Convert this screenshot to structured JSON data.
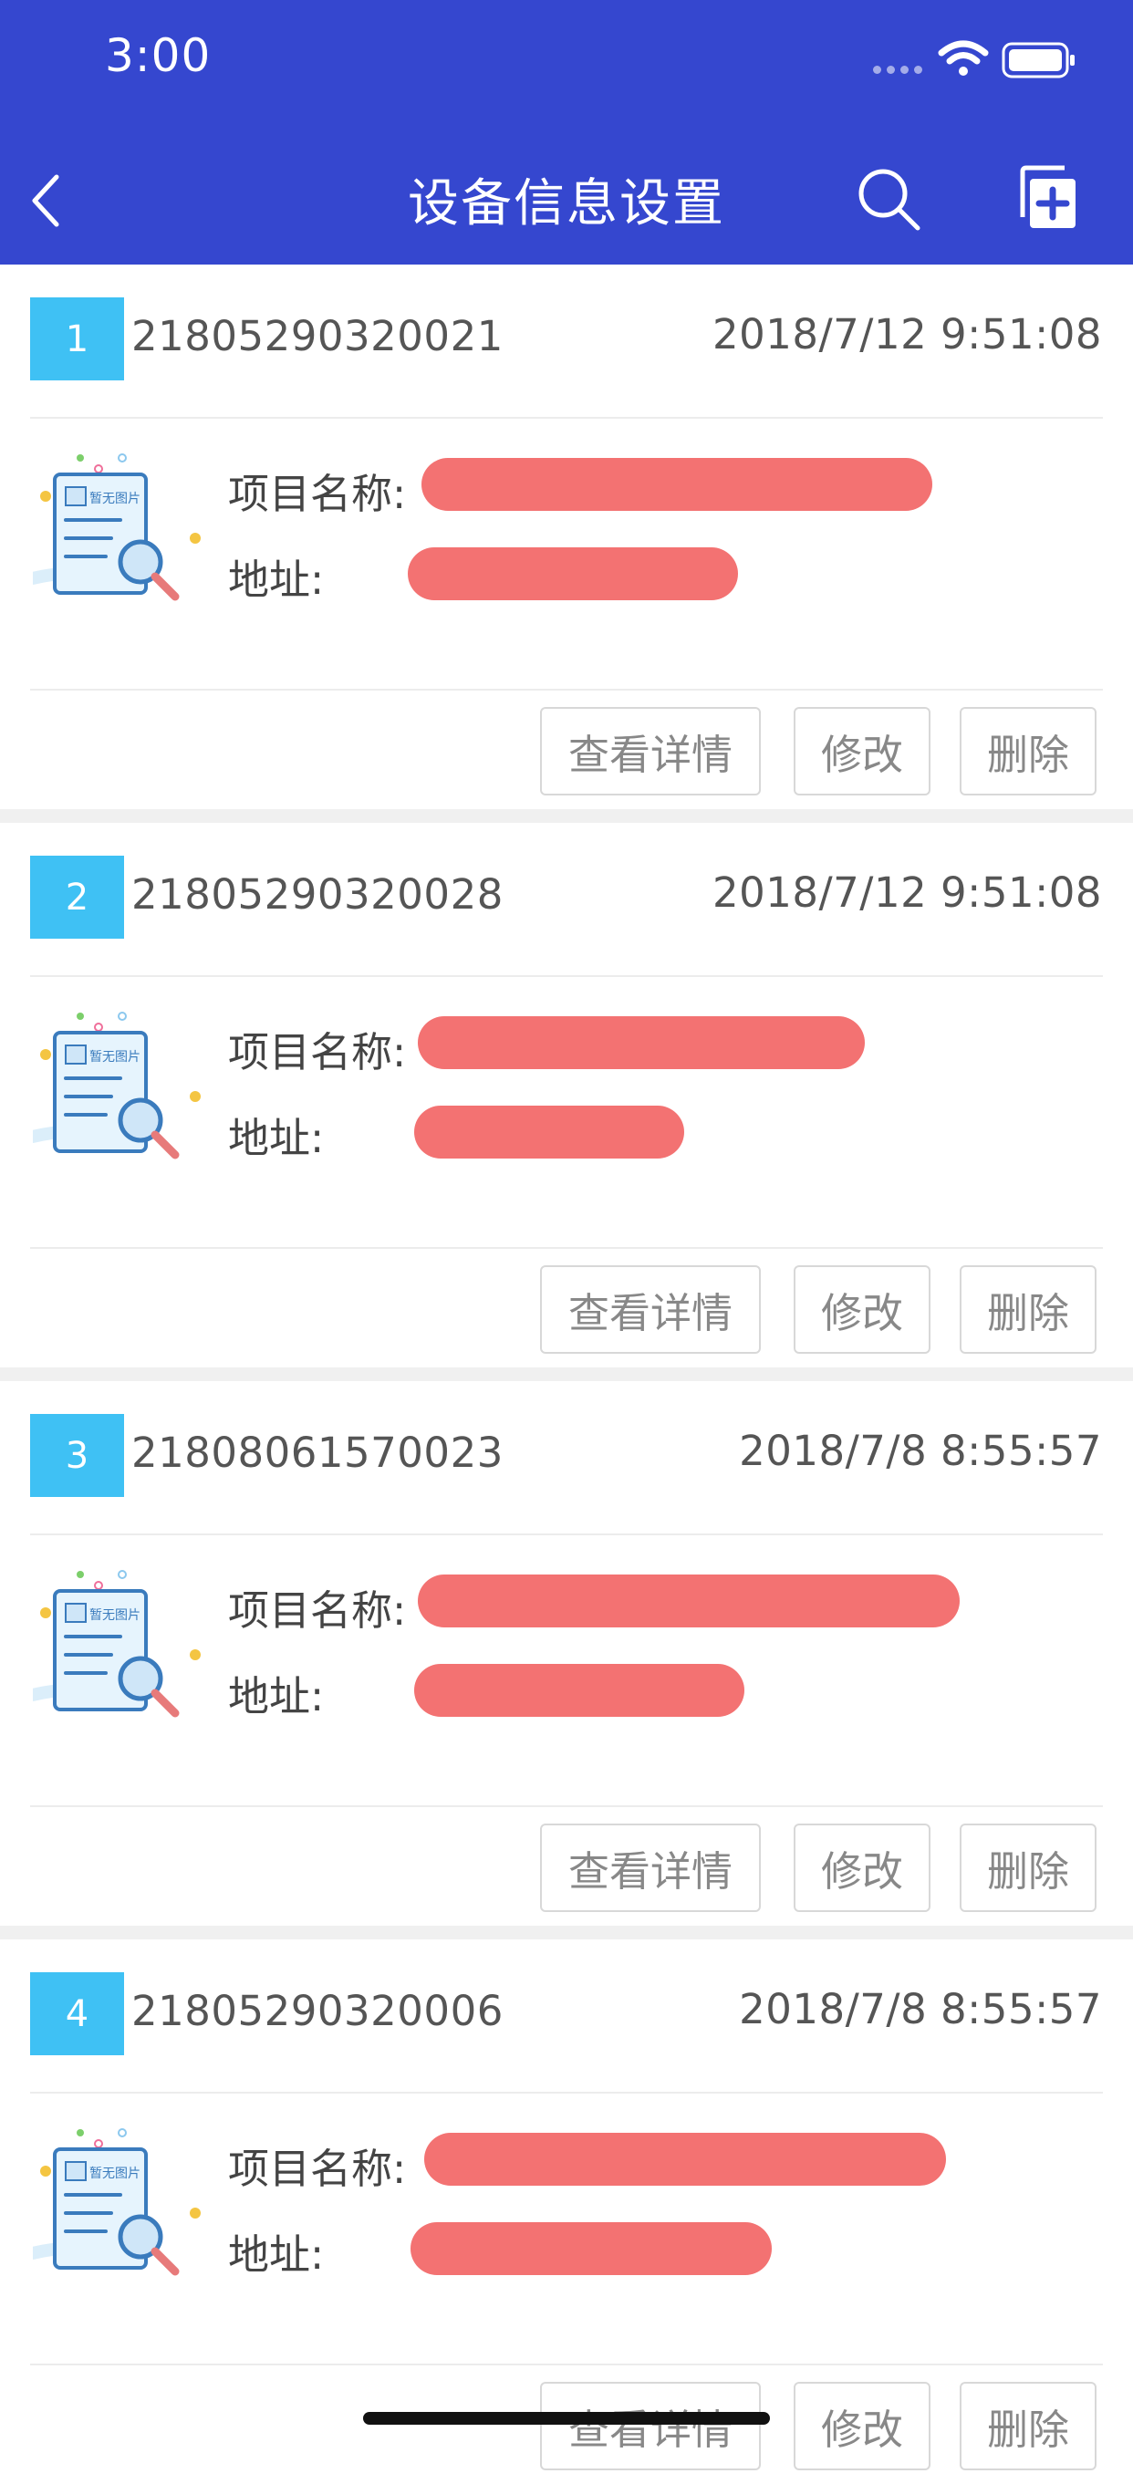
{
  "status_bar": {
    "time": "3:00"
  },
  "nav": {
    "title": "设备信息设置"
  },
  "colors": {
    "header": "#3547cf",
    "index_badge": "#3fc1f4",
    "redaction": "#f37272"
  },
  "icons": [
    "back-icon",
    "search-icon",
    "add-document-icon",
    "no-image-placeholder-icon"
  ],
  "labels": {
    "project_name": "项目名称:",
    "address": "地址:",
    "view_details": "查看详情",
    "edit": "修改",
    "delete": "删除",
    "placeholder_image": "暂无图片"
  },
  "items": [
    {
      "index": "1",
      "code": "21805290320021",
      "date": "2018/7/12 9:51:08"
    },
    {
      "index": "2",
      "code": "21805290320028",
      "date": "2018/7/12 9:51:08"
    },
    {
      "index": "3",
      "code": "21808061570023",
      "date": "2018/7/8 8:55:57"
    },
    {
      "index": "4",
      "code": "21805290320006",
      "date": "2018/7/8 8:55:57"
    }
  ]
}
